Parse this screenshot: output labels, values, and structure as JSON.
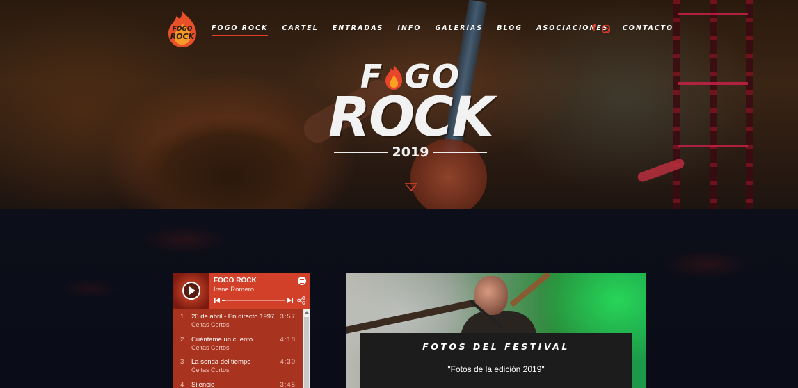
{
  "nav": {
    "logo_alt": "Fogo Rock",
    "items": [
      "FOGO ROCK",
      "CARTEL",
      "ENTRADAS",
      "INFO",
      "GALERÍAS",
      "BLOG",
      "ASOCIACIONES",
      "CONTACTO"
    ],
    "active_index": 0,
    "social": {
      "facebook_label": "f",
      "icons": [
        "facebook-icon",
        "instagram-icon"
      ]
    }
  },
  "hero": {
    "logo_line1_a": "F",
    "logo_line1_b": "GO",
    "logo_line2": "ROCK",
    "year": "2019"
  },
  "player": {
    "title": "FOGO ROCK",
    "artist": "Irene Romero",
    "progress": 0.04,
    "tracks": [
      {
        "num": "1",
        "name": "20 de abril - En directo 1997",
        "artist": "Celtas Cortos",
        "duration": "3:57"
      },
      {
        "num": "2",
        "name": "Cuéntame un cuento",
        "artist": "Celtas Cortos",
        "duration": "4:18"
      },
      {
        "num": "3",
        "name": "La senda del tiempo",
        "artist": "Celtas Cortos",
        "duration": "4:30"
      },
      {
        "num": "4",
        "name": "Silencio",
        "artist": "",
        "duration": "3:45"
      }
    ]
  },
  "gallery": {
    "title": "FOTOS DEL FESTIVAL",
    "subtitle": "\"Fotos de la edición 2019\""
  },
  "colors": {
    "accent": "#e0402a",
    "player_bg": "#a8341f",
    "page_bg": "#0b0d16"
  }
}
